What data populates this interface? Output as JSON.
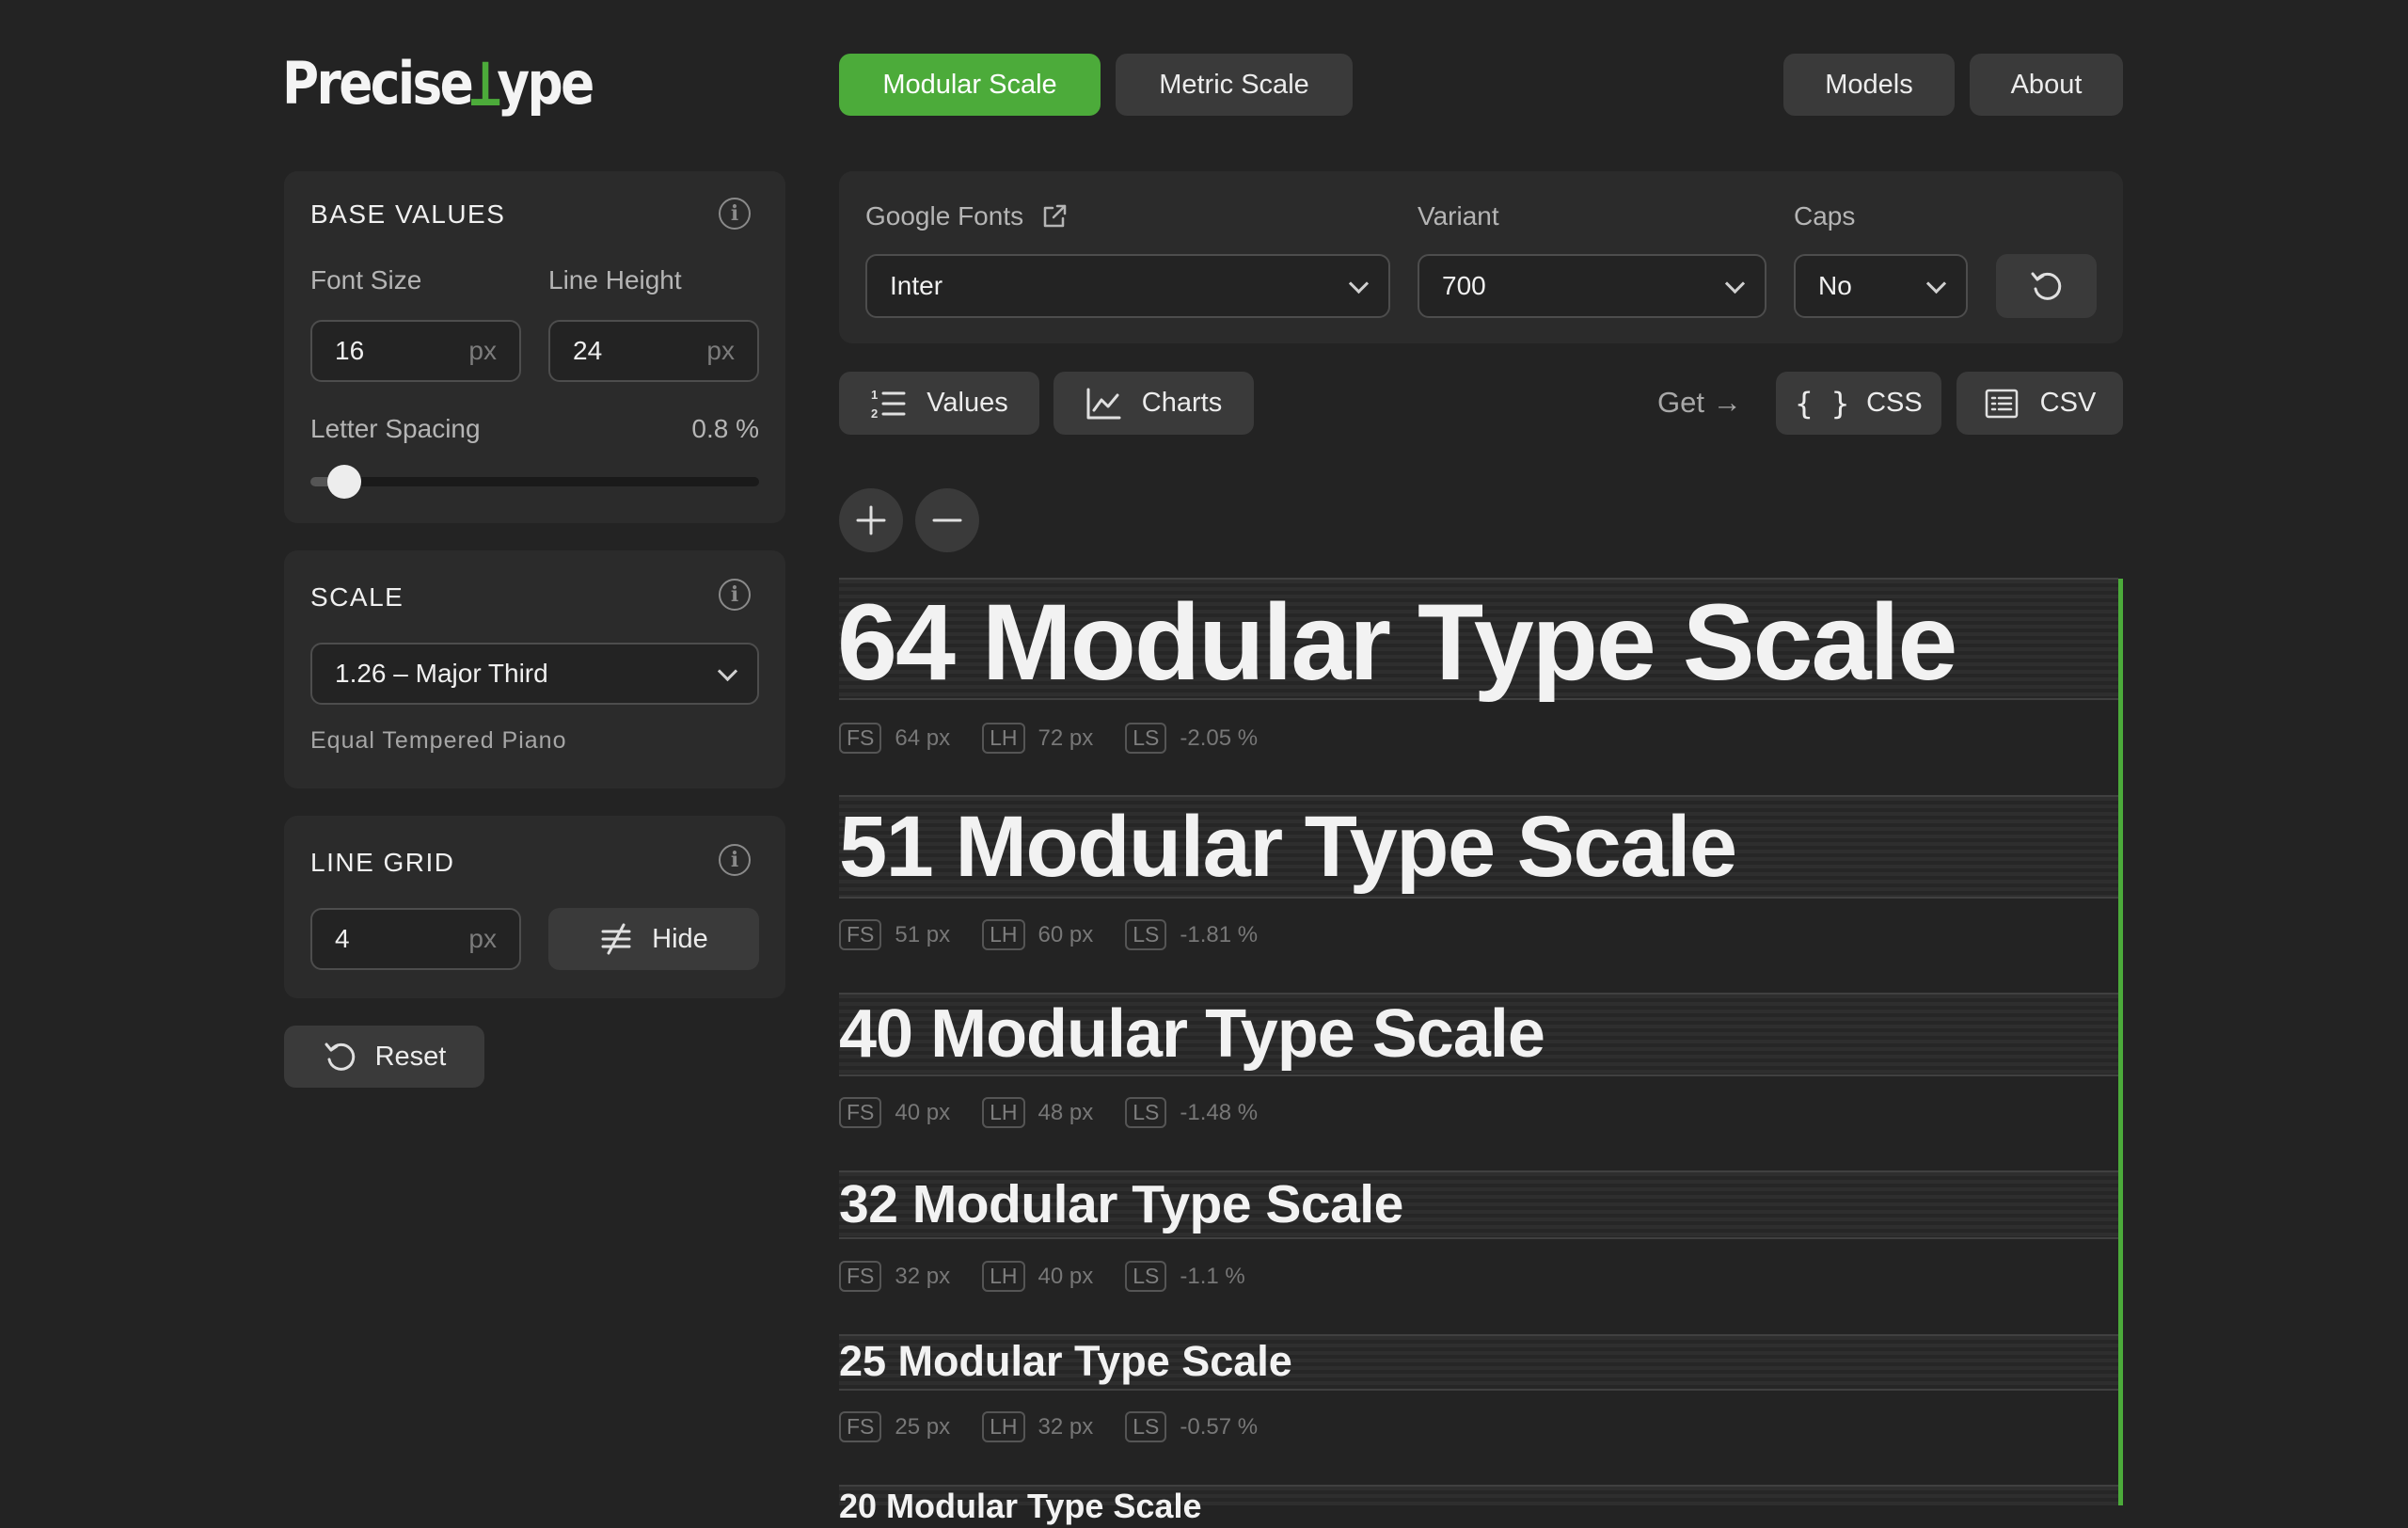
{
  "logo": {
    "part1": "Precise ",
    "mark": "Ʇ",
    "part2": "ype"
  },
  "nav": {
    "modular": "Modular Scale",
    "metric": "Metric Scale",
    "models": "Models",
    "about": "About"
  },
  "base": {
    "title": "BASE VALUES",
    "font_size_label": "Font Size",
    "font_size_value": "16",
    "line_height_label": "Line Height",
    "line_height_value": "24",
    "unit": "px",
    "letter_spacing_label": "Letter Spacing",
    "letter_spacing_value": "0.8 %",
    "letter_spacing_slider": 0.04
  },
  "scale": {
    "title": "SCALE",
    "selected": "1.26 – Major Third",
    "note": "Equal Tempered Piano"
  },
  "grid": {
    "title": "LINE GRID",
    "value": "4",
    "unit": "px",
    "hide_label": "Hide"
  },
  "reset_label": "Reset",
  "font_panel": {
    "google_fonts_label": "Google Fonts",
    "font": "Inter",
    "variant_label": "Variant",
    "variant": "700",
    "caps_label": "Caps",
    "caps": "No"
  },
  "views": {
    "values": "Values",
    "charts": "Charts"
  },
  "export": {
    "get": "Get →",
    "css": "CSS",
    "csv": "CSV"
  },
  "tags": {
    "fs": "FS",
    "lh": "LH",
    "ls": "LS"
  },
  "rows": [
    {
      "text": "64 Modular Type Scale",
      "fs": "64 px",
      "lh": "72 px",
      "ls": "-2.05 %"
    },
    {
      "text": "51 Modular Type Scale",
      "fs": "51 px",
      "lh": "60 px",
      "ls": "-1.81 %"
    },
    {
      "text": "40 Modular Type Scale",
      "fs": "40 px",
      "lh": "48 px",
      "ls": "-1.48 %"
    },
    {
      "text": "32 Modular Type Scale",
      "fs": "32 px",
      "lh": "40 px",
      "ls": "-1.1 %"
    },
    {
      "text": "25 Modular Type Scale",
      "fs": "25 px",
      "lh": "32 px",
      "ls": "-0.57 %"
    },
    {
      "text": "20 Modular Type Scale"
    }
  ],
  "colors": {
    "accent": "#4cab3a",
    "background": "#232323",
    "panel": "#2b2b2b",
    "button": "#3a3a3a"
  }
}
